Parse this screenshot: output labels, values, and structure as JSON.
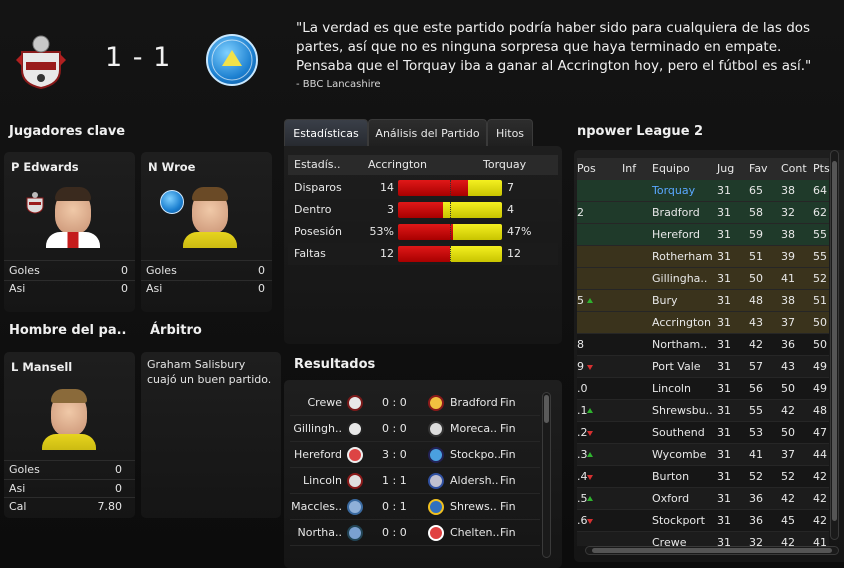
{
  "match": {
    "score": "1 - 1",
    "quote": "\"La verdad es que este partido podría haber sido para cualquiera de las dos partes, así que no es ninguna sorpresa que haya terminado en empate. Pensaba que el Torquay iba a ganar al Accrington hoy, pero el fútbol es así.\"",
    "source": "- BBC Lancashire",
    "home_crest_icon": "accrington-crest-icon",
    "away_crest_icon": "torquay-crest-icon"
  },
  "key_players": {
    "title": "Jugadores clave",
    "players": [
      {
        "name": "P Edwards",
        "stats": [
          {
            "label": "Goles",
            "value": "0"
          },
          {
            "label": "Asi",
            "value": "0"
          }
        ]
      },
      {
        "name": "N Wroe",
        "stats": [
          {
            "label": "Goles",
            "value": "0"
          },
          {
            "label": "Asi",
            "value": "0"
          }
        ]
      }
    ]
  },
  "man_of_match": {
    "title": "Hombre del pa..",
    "name": "L Mansell",
    "stats": [
      {
        "label": "Goles",
        "value": "0"
      },
      {
        "label": "Asi",
        "value": "0"
      },
      {
        "label": "Cal",
        "value": "7.80"
      }
    ]
  },
  "referee": {
    "title": "Árbitro",
    "comment": "Graham Salisbury cuajó un buen partido."
  },
  "stats": {
    "tabs": [
      "Estadísticas",
      "Análisis del Partido",
      "Hitos"
    ],
    "headers": [
      "Estadís..",
      "Accrington",
      "Torquay"
    ],
    "rows": [
      {
        "label": "Disparos",
        "home": "14",
        "away": "7",
        "home_share": 0.67
      },
      {
        "label": "Dentro",
        "home": "3",
        "away": "4",
        "home_share": 0.43
      },
      {
        "label": "Posesión",
        "home": "53%",
        "away": "47%",
        "home_share": 0.53
      },
      {
        "label": "Faltas",
        "home": "12",
        "away": "12",
        "home_share": 0.5
      }
    ],
    "colors": {
      "home": "#cc0000",
      "away": "#e0e000"
    }
  },
  "results": {
    "title": "Resultados",
    "rows": [
      {
        "home": "Crewe",
        "score": "0 : 0",
        "away": "Bradford",
        "status": "Fin"
      },
      {
        "home": "Gillingh..",
        "score": "0 : 0",
        "away": "Moreca..",
        "status": "Fin"
      },
      {
        "home": "Hereford",
        "score": "3 : 0",
        "away": "Stockpo..",
        "status": "Fin"
      },
      {
        "home": "Lincoln",
        "score": "1 : 1",
        "away": "Aldersh..",
        "status": "Fin"
      },
      {
        "home": "Maccles..",
        "score": "0 : 1",
        "away": "Shrews..",
        "status": "Fin"
      },
      {
        "home": "Northa..",
        "score": "0 : 0",
        "away": "Chelten..",
        "status": "Fin"
      }
    ]
  },
  "league": {
    "title": "npower League 2",
    "headers": [
      "Pos",
      "Inf",
      "Equipo",
      "Jug",
      "Fav",
      "Cont",
      "Pts"
    ],
    "rows": [
      {
        "pos": "",
        "trend": "",
        "team": "Torquay",
        "p": "31",
        "f": "65",
        "a": "38",
        "pts": "64"
      },
      {
        "pos": "2",
        "trend": "",
        "team": "Bradford",
        "p": "31",
        "f": "58",
        "a": "32",
        "pts": "62"
      },
      {
        "pos": "",
        "trend": "",
        "team": "Hereford",
        "p": "31",
        "f": "59",
        "a": "38",
        "pts": "55"
      },
      {
        "pos": "",
        "trend": "",
        "team": "Rotherham",
        "p": "31",
        "f": "51",
        "a": "39",
        "pts": "55"
      },
      {
        "pos": "",
        "trend": "",
        "team": "Gillingha..",
        "p": "31",
        "f": "50",
        "a": "41",
        "pts": "52"
      },
      {
        "pos": "5",
        "trend": "up",
        "team": "Bury",
        "p": "31",
        "f": "48",
        "a": "38",
        "pts": "51"
      },
      {
        "pos": "",
        "trend": "",
        "team": "Accrington",
        "p": "31",
        "f": "43",
        "a": "37",
        "pts": "50"
      },
      {
        "pos": "8",
        "trend": "",
        "team": "Northam..",
        "p": "31",
        "f": "42",
        "a": "36",
        "pts": "50"
      },
      {
        "pos": "9",
        "trend": "down",
        "team": "Port Vale",
        "p": "31",
        "f": "57",
        "a": "43",
        "pts": "49"
      },
      {
        "pos": ".0",
        "trend": "",
        "team": "Lincoln",
        "p": "31",
        "f": "56",
        "a": "50",
        "pts": "49"
      },
      {
        "pos": ".1",
        "trend": "up",
        "team": "Shrewsbu..",
        "p": "31",
        "f": "55",
        "a": "42",
        "pts": "48"
      },
      {
        "pos": ".2",
        "trend": "down",
        "team": "Southend",
        "p": "31",
        "f": "53",
        "a": "50",
        "pts": "47"
      },
      {
        "pos": ".3",
        "trend": "up",
        "team": "Wycombe",
        "p": "31",
        "f": "41",
        "a": "37",
        "pts": "44"
      },
      {
        "pos": ".4",
        "trend": "down",
        "team": "Burton",
        "p": "31",
        "f": "52",
        "a": "52",
        "pts": "42"
      },
      {
        "pos": ".5",
        "trend": "up",
        "team": "Oxford",
        "p": "31",
        "f": "36",
        "a": "42",
        "pts": "42"
      },
      {
        "pos": ".6",
        "trend": "down",
        "team": "Stockport",
        "p": "31",
        "f": "36",
        "a": "45",
        "pts": "42"
      },
      {
        "pos": "",
        "trend": "",
        "team": "Crewe",
        "p": "31",
        "f": "32",
        "a": "42",
        "pts": "41"
      }
    ]
  }
}
